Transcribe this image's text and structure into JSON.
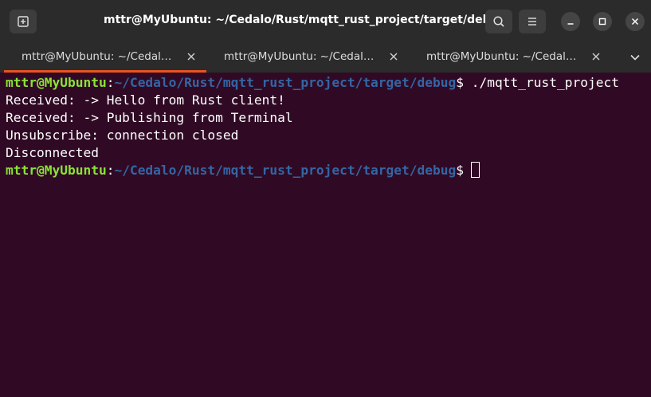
{
  "window": {
    "title": "mttr@MyUbuntu: ~/Cedalo/Rust/mqtt_rust_project/target/debug"
  },
  "icons": {
    "new_tab": "new-tab-icon",
    "search": "search-icon",
    "menu": "hamburger-menu-icon",
    "minimize": "minimize-icon",
    "maximize": "maximize-icon",
    "close": "close-icon",
    "tab_close": "close-icon",
    "tab_overflow": "chevron-down-icon"
  },
  "colors": {
    "terminal_bg": "#300a24",
    "prompt_user": "#8ae234",
    "prompt_path": "#3465a4",
    "active_tab": "#e95420"
  },
  "tabs": [
    {
      "label": "mttr@MyUbuntu: ~/Cedal…",
      "active": true
    },
    {
      "label": "mttr@MyUbuntu: ~/Cedal…",
      "active": false
    },
    {
      "label": "mttr@MyUbuntu: ~/Cedal…",
      "active": false
    }
  ],
  "terminal": {
    "prompt_user": "mttr@MyUbuntu",
    "prompt_sep": ":",
    "prompt_path": "~/Cedalo/Rust/mqtt_rust_project/target/debug",
    "prompt_symbol": "$ ",
    "command": "./mqtt_rust_project",
    "output": [
      "Received: -> Hello from Rust client!",
      "Received: -> Publishing from Terminal",
      "Unsubscribe: connection closed",
      "Disconnected"
    ]
  }
}
